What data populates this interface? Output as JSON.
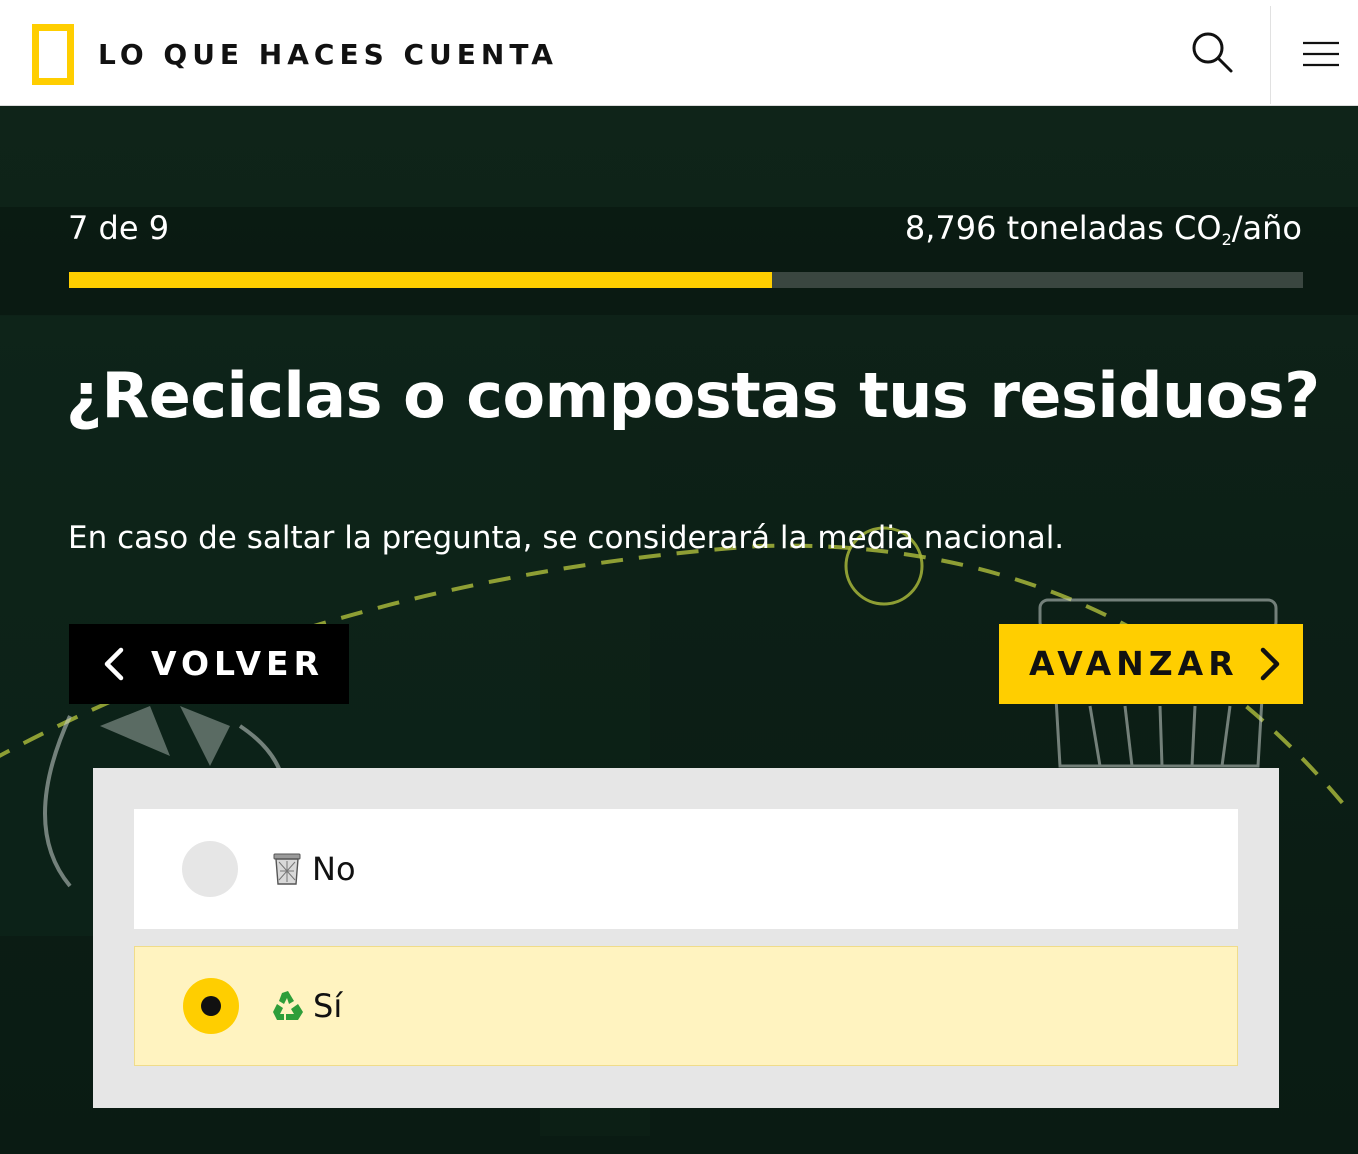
{
  "header": {
    "brand": "LO QUE HACES CUENTA",
    "logo_icon": "nat-geo-yellow-frame-icon",
    "search_icon": "search-icon",
    "menu_icon": "hamburger-menu-icon"
  },
  "quiz": {
    "step": "7 de 9",
    "step_current": 7,
    "step_total": 9,
    "emissions_value": "8,796 toneladas CO",
    "emissions_sub": "2",
    "emissions_unit": "/año",
    "progress_fraction": 0.57,
    "question": "¿Reciclas o compostas tus residuos?",
    "hint": "En caso de saltar la pregunta, se considerará la media nacional.",
    "back_label": "VOLVER",
    "next_label": "AVANZAR",
    "options": [
      {
        "label": "No",
        "icon": "trash-can-icon",
        "selected": false
      },
      {
        "label": "Sí",
        "icon": "recycle-icon",
        "selected": true
      }
    ]
  },
  "colors": {
    "accent": "#ffce00",
    "background": "#0c1d15",
    "selected_option_bg": "#fff3c0",
    "panel_bg": "#e6e6e6"
  }
}
